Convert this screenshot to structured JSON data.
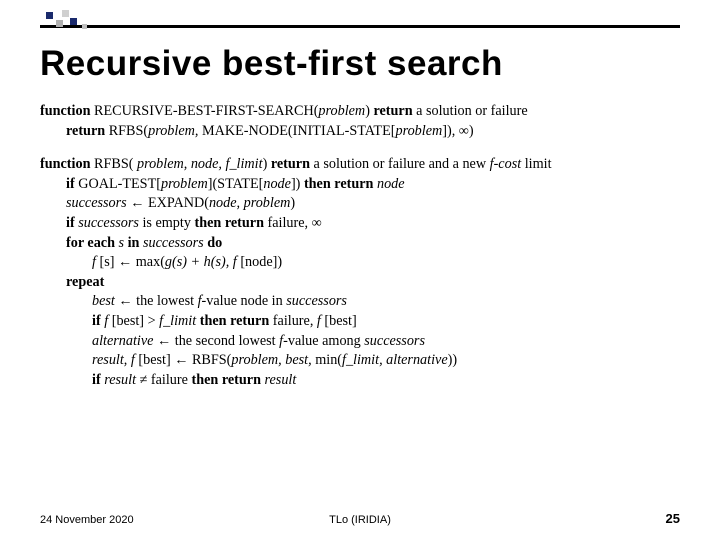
{
  "title": "Recursive best-first search",
  "fn1": {
    "kw_function": "function",
    "name": " RECURSIVE-BEST-FIRST-SEARCH(",
    "arg": "problem",
    "after_arg": ") ",
    "kw_return": "return",
    "ret_desc": " a solution or failure",
    "l2_kw": "return",
    "l2_txt": " RFBS(",
    "l2_arg": "problem,",
    "l2_rest": " MAKE-NODE(INITIAL-STATE[",
    "l2_arg2": "problem",
    "l2_tail": "]), ∞)"
  },
  "fn2": {
    "kw_function": "function",
    "name": " RFBS( ",
    "args": "problem, node, f_limit",
    "after_args": ") ",
    "kw_return": "return",
    "ret_desc": " a solution or failure and a new ",
    "ret_i": "f-cost",
    "ret_tail": " limit",
    "l_if": "if",
    "l_goal": " GOAL-TEST[",
    "l_goal_a": "problem",
    "l_goal_mid": "](STATE[",
    "l_goal_b": "node",
    "l_goal_end": "]) ",
    "l_then": "then return ",
    "l_then_i": "node",
    "succ_i": "successors",
    "succ_mid": " ← EXPAND(",
    "succ_args": "node, problem",
    "succ_end": ")",
    "e_if": "if ",
    "e_i": "successors",
    "e_mid": " is empty ",
    "e_then": "then return ",
    "e_tail": "failure, ∞",
    "fe_kw": "for each ",
    "fe_s": "s",
    "fe_in": " in ",
    "fe_succ": "successors",
    "fe_do": " do",
    "fs_lhs": "f ",
    "fs_s": "[s]",
    "fs_mid": " ← max(",
    "fs_g": "g(s) + h(s), f ",
    "fs_node": "[node]",
    "fs_end": ")",
    "repeat": "repeat",
    "best_i": "best",
    "best_mid": " ← the lowest ",
    "best_f": "f-",
    "best_tail": "value node in ",
    "best_succ": "successors",
    "cmp_if": "if ",
    "cmp_lhs": "f ",
    "cmp_b": "[best]",
    "cmp_gt": " > ",
    "cmp_fl": "f_limit",
    "cmp_then": " then return ",
    "cmp_fail": "failure",
    "cmp_comma": ", ",
    "cmp_fb": "f ",
    "cmp_fb2": "[best]",
    "alt_i": "alternative",
    "alt_mid": " ← the second lowest ",
    "alt_f": "f-",
    "alt_tail": "value among ",
    "alt_succ": "successors",
    "res_i": "result, f ",
    "res_b": "[best]",
    "res_mid": " ← RBFS(",
    "res_args": "problem, best, ",
    "res_min": "min(",
    "res_min_args": "f_limit, alternative",
    "res_end": "))",
    "r_if": "if ",
    "r_res": "result ",
    "r_ne": "≠ failure ",
    "r_then": "then return ",
    "r_ret": "result"
  },
  "footer": {
    "date": "24 November 2020",
    "center": "TLo (IRIDIA)",
    "page": "25"
  }
}
